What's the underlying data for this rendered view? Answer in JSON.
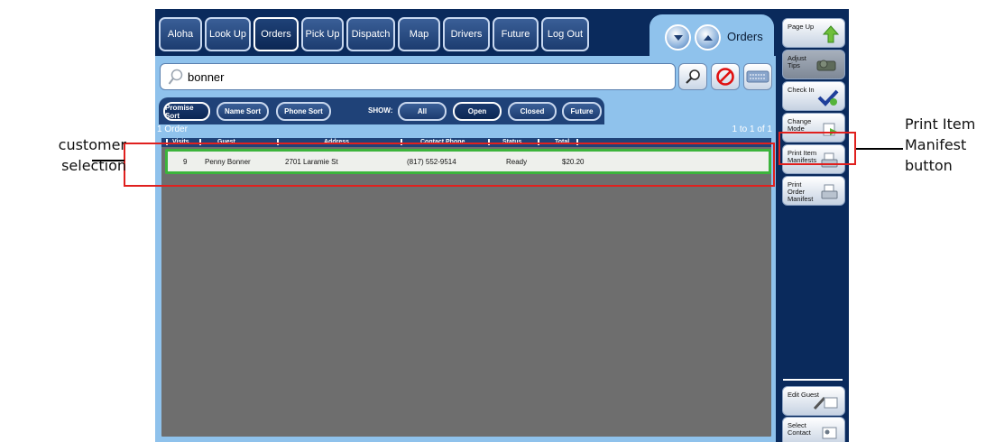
{
  "nav": {
    "items": [
      "Aloha",
      "Look Up",
      "Orders",
      "Pick Up",
      "Dispatch",
      "Map",
      "Drivers",
      "Future",
      "Log Out"
    ],
    "active": "Orders"
  },
  "orders_tab": {
    "label": "Orders"
  },
  "search": {
    "value": "bonner"
  },
  "sort_bar": {
    "sort_buttons": [
      "Promise Sort",
      "Name Sort",
      "Phone Sort"
    ],
    "show_label": "SHOW:",
    "filters": [
      "All",
      "Open",
      "Closed",
      "Future"
    ],
    "active_sort": "Promise Sort",
    "active_filter": "Open"
  },
  "list": {
    "count_label": "1 Order",
    "page_label": "1 to 1 of 1",
    "columns": [
      "Visits",
      "Guest",
      "Address",
      "Contact Phone",
      "Status",
      "Total"
    ],
    "rows": [
      {
        "visits": "9",
        "guest": "Penny Bonner",
        "address": "2701 Laramie St",
        "phone": "(817) 552-9514",
        "status": "Ready",
        "total": "$20.20"
      }
    ]
  },
  "side_buttons": [
    {
      "label": "Page Up",
      "icon": "arrow-up-icon"
    },
    {
      "label": "Adjust Tips",
      "icon": "cash-icon"
    },
    {
      "label": "Check In",
      "icon": "check-icon"
    },
    {
      "label": "Change Mode",
      "icon": "change-mode-icon"
    },
    {
      "label": "Print Item Manifests",
      "icon": "printer-icon"
    },
    {
      "label": "Print Order Manifest",
      "icon": "printer-icon"
    },
    {
      "label": "Edit Guest",
      "icon": "edit-guest-icon"
    },
    {
      "label": "Select Contact",
      "icon": "contact-card-icon"
    }
  ],
  "annotations": {
    "customer_selection": "customer\nselection",
    "print_item_manifest": "Print Item\nManifest\nbutton"
  },
  "colors": {
    "highlight": "#e0201e",
    "selected_row": "#3cb43c",
    "nav_bg": "#0a2a5c",
    "panel_bg": "#8fc2ec"
  }
}
